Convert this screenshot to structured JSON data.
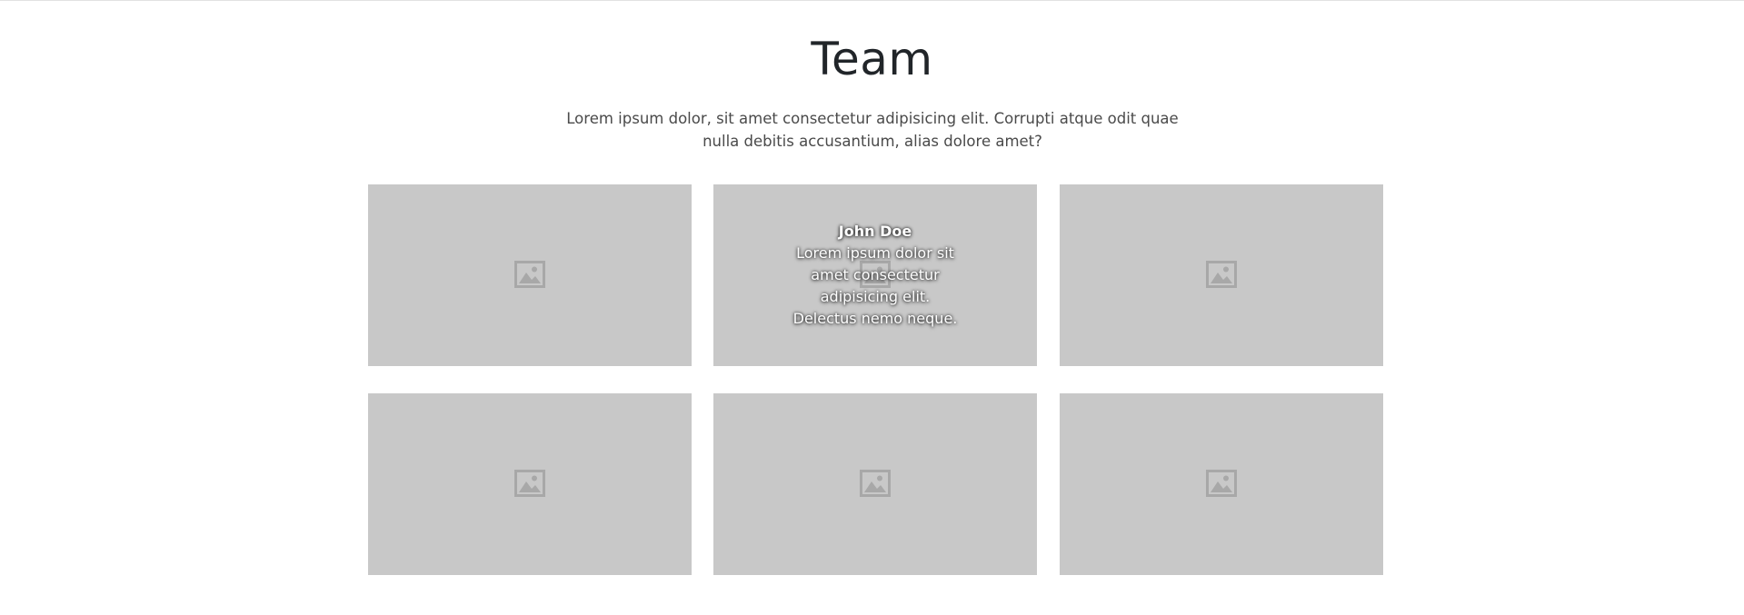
{
  "team_section": {
    "title": "Team",
    "intro": "Lorem ipsum dolor, sit amet consectetur adipisicing elit. Corrupti atque odit quae nulla debitis accusantium, alias dolore amet?"
  },
  "members": [
    {
      "image_icon": "image-placeholder-icon"
    },
    {
      "image_icon": "image-placeholder-icon",
      "name": "John Doe",
      "bio": "Lorem ipsum dolor sit amet consectetur adipisicing elit. Delectus nemo neque."
    },
    {
      "image_icon": "image-placeholder-icon"
    },
    {
      "image_icon": "image-placeholder-icon"
    },
    {
      "image_icon": "image-placeholder-icon"
    },
    {
      "image_icon": "image-placeholder-icon"
    }
  ],
  "colors": {
    "card_background": "#c8c8c8",
    "icon": "#a8a8a8",
    "title": "#212529",
    "overlay_text": "#ffffff"
  }
}
